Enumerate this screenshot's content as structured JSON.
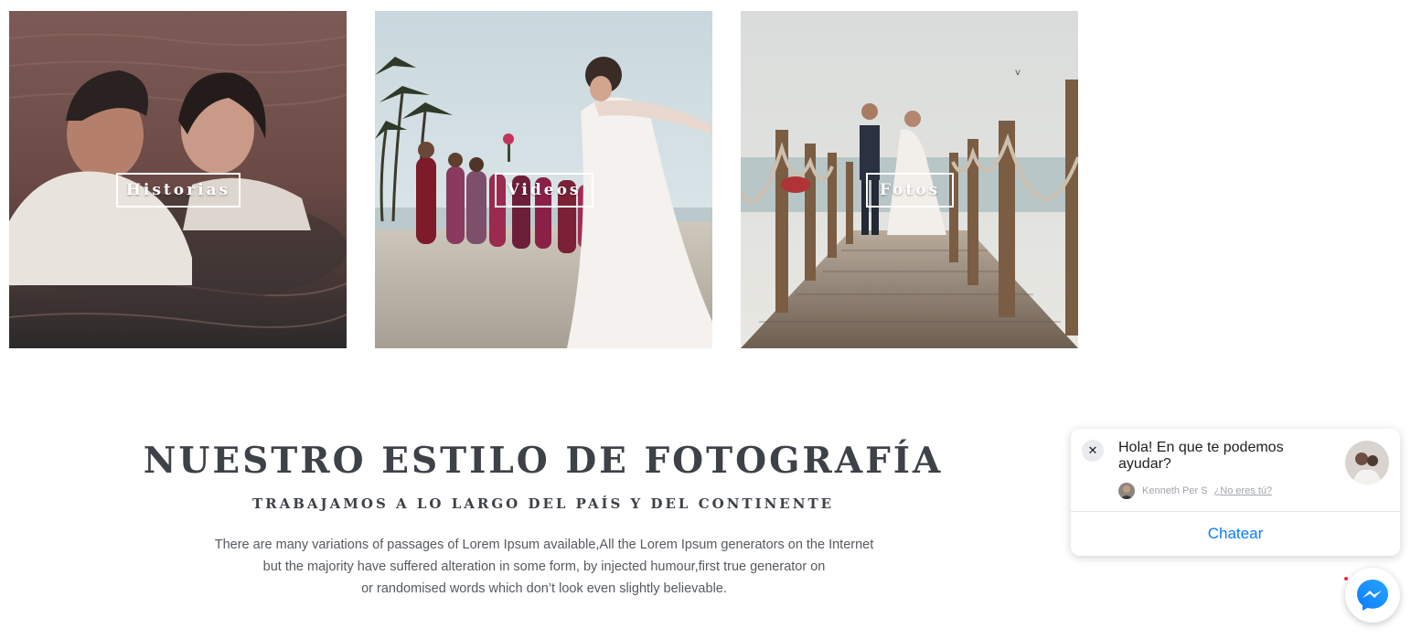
{
  "tiles": [
    {
      "label": "Historias"
    },
    {
      "label": "Videos"
    },
    {
      "label": "Fotos"
    }
  ],
  "section": {
    "title": "NUESTRO ESTILO DE FOTOGRAFÍA",
    "subtitle": "TRABAJAMOS A LO LARGO DEL PAÍS Y DEL CONTINENTE",
    "body_lines": [
      "There are many variations of passages of Lorem Ipsum available,All the Lorem Ipsum generators on the Internet",
      "but the majority have suffered alteration in some form, by injected humour,first true generator on",
      "or randomised words which don’t look even slightly believable."
    ]
  },
  "chat": {
    "close_glyph": "✕",
    "greeting": "Hola! En que te podemos ayudar?",
    "agent_name": "Kenneth Per S",
    "not_you": "¿No eres tú?",
    "button_label": "Chatear",
    "accent_color": "#0a7cff"
  },
  "icons": [
    "close-icon",
    "messenger-icon"
  ]
}
